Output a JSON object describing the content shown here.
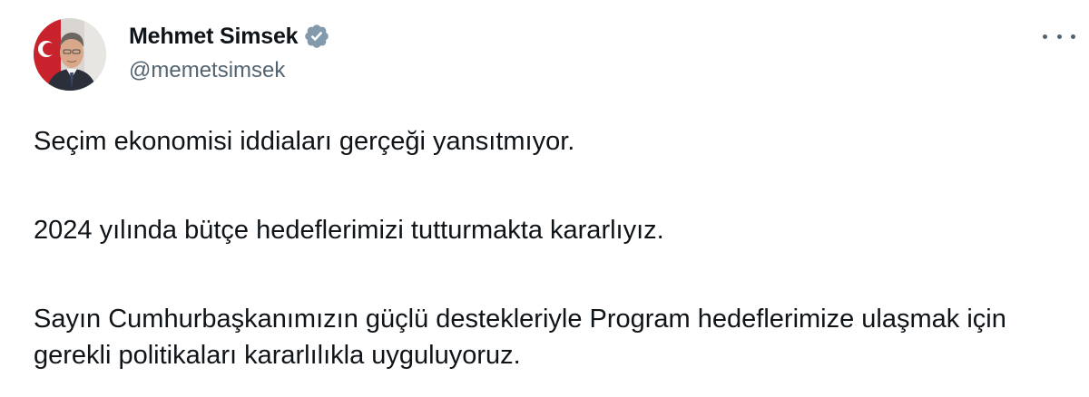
{
  "author": {
    "display_name": "Mehmet Simsek",
    "handle": "@memetsimsek",
    "verified_icon": "verified-badge-icon",
    "verified_color": "#829aab"
  },
  "menu": {
    "more_icon": "more-horizontal-icon"
  },
  "tweet": {
    "paragraphs": [
      "Seçim ekonomisi iddiaları gerçeği yansıtmıyor.",
      "2024 yılında bütçe hedeflerimizi tutturmakta kararlıyız.",
      "Sayın Cumhurbaşkanımızın güçlü destekleriyle Program hedeflerimize ulaşmak için gerekli politikaları kararlılıkla uyguluyoruz."
    ]
  },
  "colors": {
    "text_primary": "#0f1419",
    "text_secondary": "#536471",
    "background": "#ffffff"
  }
}
